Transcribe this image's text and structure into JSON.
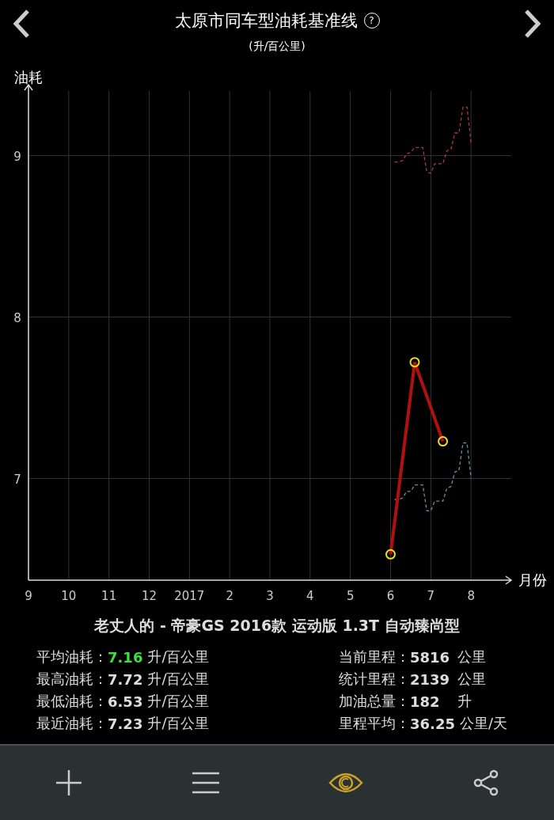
{
  "header": {
    "title": "太原市同车型油耗基准线",
    "help": "?",
    "subtitle": "(升/百公里)"
  },
  "chart": {
    "chart_data": {
      "type": "line",
      "ylabel": "油耗",
      "xlabel": "月份",
      "categories": [
        "9",
        null,
        null,
        null,
        null,
        null,
        null,
        null,
        null,
        null,
        "10",
        null,
        null,
        null,
        null,
        null,
        null,
        null,
        null,
        null,
        "11",
        null,
        null,
        null,
        null,
        null,
        null,
        null,
        null,
        null,
        "12",
        null,
        null,
        null,
        null,
        null,
        null,
        null,
        null,
        null,
        "2017",
        null,
        null,
        null,
        null,
        null,
        null,
        null,
        null,
        null,
        "2",
        null,
        null,
        null,
        null,
        null,
        null,
        null,
        null,
        null,
        "3",
        null,
        null,
        null,
        null,
        null,
        null,
        null,
        null,
        null,
        "4",
        null,
        null,
        null,
        null,
        null,
        null,
        null,
        null,
        null,
        "5",
        null,
        null,
        null,
        null,
        null,
        null,
        null,
        null,
        null,
        "6",
        null,
        null,
        null,
        null,
        null,
        null,
        null,
        null,
        null,
        "7",
        null,
        null,
        null,
        null,
        null,
        null,
        null,
        null,
        null,
        "8"
      ],
      "grid": true,
      "ylim": [
        6.37,
        9.4
      ],
      "yticks": [
        7,
        8,
        9
      ],
      "series": [
        {
          "color": "#b03a3a",
          "line_style": "dashed",
          "values": [
            null,
            null,
            null,
            null,
            null,
            null,
            null,
            null,
            null,
            null,
            null,
            null,
            null,
            null,
            null,
            null,
            null,
            null,
            null,
            null,
            null,
            null,
            null,
            null,
            null,
            null,
            null,
            null,
            null,
            null,
            null,
            null,
            null,
            null,
            null,
            null,
            null,
            null,
            null,
            null,
            null,
            null,
            null,
            null,
            null,
            null,
            null,
            null,
            null,
            null,
            null,
            null,
            null,
            null,
            null,
            null,
            null,
            null,
            null,
            null,
            null,
            null,
            null,
            null,
            null,
            null,
            null,
            null,
            null,
            null,
            null,
            null,
            null,
            null,
            null,
            null,
            null,
            null,
            null,
            null,
            null,
            null,
            null,
            null,
            null,
            null,
            null,
            null,
            null,
            null,
            null,
            8.96,
            8.96,
            8.97,
            9.01,
            9.02,
            9.05,
            9.05,
            9.05,
            8.9,
            8.89,
            8.95,
            8.95,
            8.95,
            9.03,
            9.04,
            9.14,
            9.14,
            9.3,
            9.3,
            9.08
          ]
        },
        {
          "color": "#6a8fa0",
          "line_style": "dashed",
          "values": [
            null,
            null,
            null,
            null,
            null,
            null,
            null,
            null,
            null,
            null,
            null,
            null,
            null,
            null,
            null,
            null,
            null,
            null,
            null,
            null,
            null,
            null,
            null,
            null,
            null,
            null,
            null,
            null,
            null,
            null,
            null,
            null,
            null,
            null,
            null,
            null,
            null,
            null,
            null,
            null,
            null,
            null,
            null,
            null,
            null,
            null,
            null,
            null,
            null,
            null,
            null,
            null,
            null,
            null,
            null,
            null,
            null,
            null,
            null,
            null,
            null,
            null,
            null,
            null,
            null,
            null,
            null,
            null,
            null,
            null,
            null,
            null,
            null,
            null,
            null,
            null,
            null,
            null,
            null,
            null,
            null,
            null,
            null,
            null,
            null,
            null,
            null,
            null,
            null,
            null,
            null,
            6.87,
            6.87,
            6.88,
            6.92,
            6.92,
            6.96,
            6.96,
            6.96,
            6.8,
            6.8,
            6.86,
            6.86,
            6.86,
            6.94,
            6.95,
            7.04,
            7.05,
            7.22,
            7.22,
            7.0
          ]
        },
        {
          "color": "#b01010",
          "line_style": "solid",
          "marker": "circle",
          "values": [
            null,
            null,
            null,
            null,
            null,
            null,
            null,
            null,
            null,
            null,
            null,
            null,
            null,
            null,
            null,
            null,
            null,
            null,
            null,
            null,
            null,
            null,
            null,
            null,
            null,
            null,
            null,
            null,
            null,
            null,
            null,
            null,
            null,
            null,
            null,
            null,
            null,
            null,
            null,
            null,
            null,
            null,
            null,
            null,
            null,
            null,
            null,
            null,
            null,
            null,
            null,
            null,
            null,
            null,
            null,
            null,
            null,
            null,
            null,
            null,
            null,
            null,
            null,
            null,
            null,
            null,
            null,
            null,
            null,
            null,
            null,
            null,
            null,
            null,
            null,
            null,
            null,
            null,
            null,
            null,
            null,
            null,
            null,
            null,
            null,
            null,
            null,
            null,
            null,
            null,
            6.53,
            null,
            null,
            null,
            null,
            null,
            7.72,
            null,
            null,
            null,
            null,
            null,
            null,
            7.23,
            null,
            null,
            null,
            null,
            null,
            null,
            null
          ]
        }
      ]
    }
  },
  "car": "老丈人的 - 帝豪GS 2016款 运动版 1.3T 自动臻尚型",
  "stats_left": [
    {
      "label": "平均油耗：",
      "value": "7.16",
      "unit": "升/百公里",
      "highlight": true
    },
    {
      "label": "最高油耗：",
      "value": "7.72",
      "unit": "升/百公里",
      "highlight": false
    },
    {
      "label": "最低油耗：",
      "value": "6.53",
      "unit": "升/百公里",
      "highlight": false
    },
    {
      "label": "最近油耗：",
      "value": "7.23",
      "unit": "升/百公里",
      "highlight": false
    }
  ],
  "stats_right": [
    {
      "label": "当前里程：",
      "value": "5816",
      "unit": "公里",
      "highlight": false
    },
    {
      "label": "统计里程：",
      "value": "2139",
      "unit": "公里",
      "highlight": false
    },
    {
      "label": "加油总量：",
      "value": "182",
      "unit": "升",
      "highlight": false
    },
    {
      "label": "里程平均：",
      "value": "36.25",
      "unit": "公里/天",
      "highlight": false
    }
  ],
  "toolbar": [
    {
      "kind": "add",
      "selected": false
    },
    {
      "kind": "menu",
      "selected": false
    },
    {
      "kind": "view",
      "selected": true
    },
    {
      "kind": "share",
      "selected": false
    }
  ]
}
